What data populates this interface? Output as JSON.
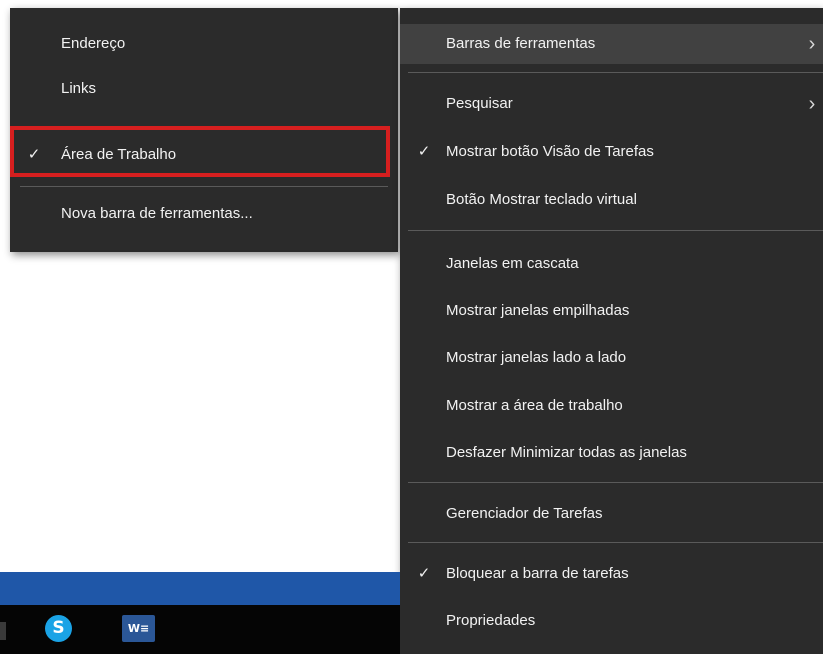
{
  "submenu": {
    "items": [
      {
        "label": "Endereço",
        "checked": false
      },
      {
        "label": "Links",
        "checked": false
      },
      {
        "label": "Área de Trabalho",
        "checked": true
      },
      {
        "label": "Nova barra de ferramentas...",
        "checked": false
      }
    ]
  },
  "mainmenu": {
    "items": [
      {
        "label": "Barras de ferramentas",
        "has_submenu": true
      },
      {
        "label": "Pesquisar",
        "has_submenu": true
      },
      {
        "label": "Mostrar botão Visão de Tarefas",
        "checked": true
      },
      {
        "label": "Botão Mostrar teclado virtual"
      },
      {
        "label": "Janelas em cascata"
      },
      {
        "label": "Mostrar janelas empilhadas"
      },
      {
        "label": "Mostrar janelas lado a lado"
      },
      {
        "label": "Mostrar a área de trabalho"
      },
      {
        "label": "Desfazer Minimizar todas as janelas"
      },
      {
        "label": "Gerenciador de Tarefas"
      },
      {
        "label": "Bloquear a barra de tarefas",
        "checked": true
      },
      {
        "label": "Propriedades"
      }
    ]
  },
  "glyphs": {
    "check": "✓",
    "arrow": "›"
  },
  "taskbar": {
    "icons": [
      {
        "name": "skype-icon",
        "glyph": "S"
      },
      {
        "name": "word-icon",
        "glyph": "W≡"
      }
    ]
  },
  "colors": {
    "menu_bg": "#2b2b2b",
    "hover_bg": "#414141",
    "highlight_border": "#d61f1f",
    "taskbar_accent": "#1f57a8"
  }
}
